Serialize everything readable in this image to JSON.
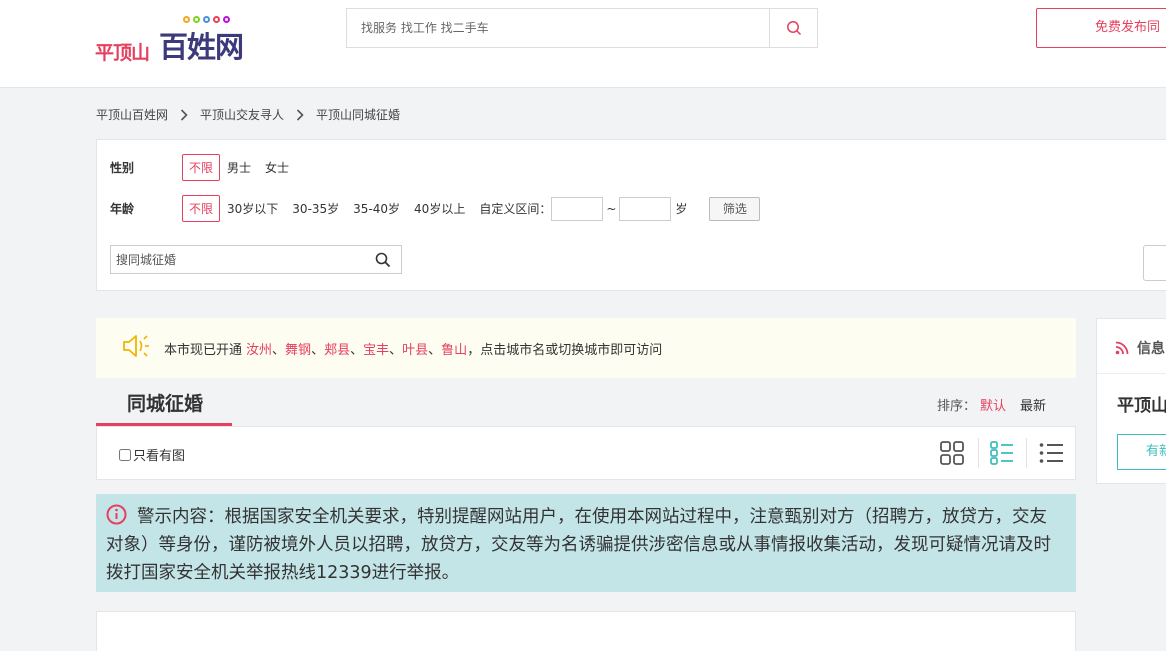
{
  "header": {
    "logo_city": "平顶山",
    "logo_brand": "百姓网",
    "logo_dot_colors": [
      "#f5a623",
      "#7ed321",
      "#4a90e2",
      "#e5405e",
      "#bd10e0"
    ],
    "search_placeholder": "找服务 找工作 找二手车",
    "publish_label": "免费发布同"
  },
  "breadcrumb": [
    "平顶山百姓网",
    "平顶山交友寻人",
    "平顶山同城征婚"
  ],
  "filter": {
    "gender": {
      "label": "性别",
      "selected": "不限",
      "options": [
        "男士",
        "女士"
      ]
    },
    "age": {
      "label": "年龄",
      "selected": "不限",
      "options": [
        "30岁以下",
        "30-35岁",
        "35-40岁",
        "40岁以上"
      ],
      "custom_label": "自定义区间：",
      "tilde": "~",
      "unit": "岁",
      "screen_button": "筛选"
    },
    "search_placeholder": "搜同城征婚"
  },
  "notice": {
    "prefix": "本市现已开通",
    "cities": [
      "汝州",
      "舞钢",
      "郏县",
      "宝丰",
      "叶县",
      "鲁山"
    ],
    "separator": "、",
    "suffix": "，点击城市名或切换城市即可访问"
  },
  "listing": {
    "tab_title": "同城征婚",
    "sort_label": "排序：",
    "sort_default": "默认",
    "sort_newest": "最新",
    "only_photos_label": "只看有图"
  },
  "warning": {
    "text": "警示内容：根据国家安全机关要求，特别提醒网站用户，在使用本网站过程中，注意甄别对方（招聘方，放贷方，交友对象）等身份，谨防被境外人员以招聘，放贷方，交友等为名诱骗提供涉密信息或从事情报收集活动，发现可疑情况请及时拨打国家安全机关举报热线12339进行举报。"
  },
  "side_panel": {
    "title": "信息",
    "city_name": "平顶山",
    "button_label": "有新"
  },
  "colors": {
    "accent": "#e5405e",
    "brand_navy": "#3d3a7c",
    "teal": "#3bbdbd",
    "warning_bg": "#c4e5e8",
    "notice_bg": "#fefdf2",
    "speaker_yellow": "#f0b400"
  }
}
